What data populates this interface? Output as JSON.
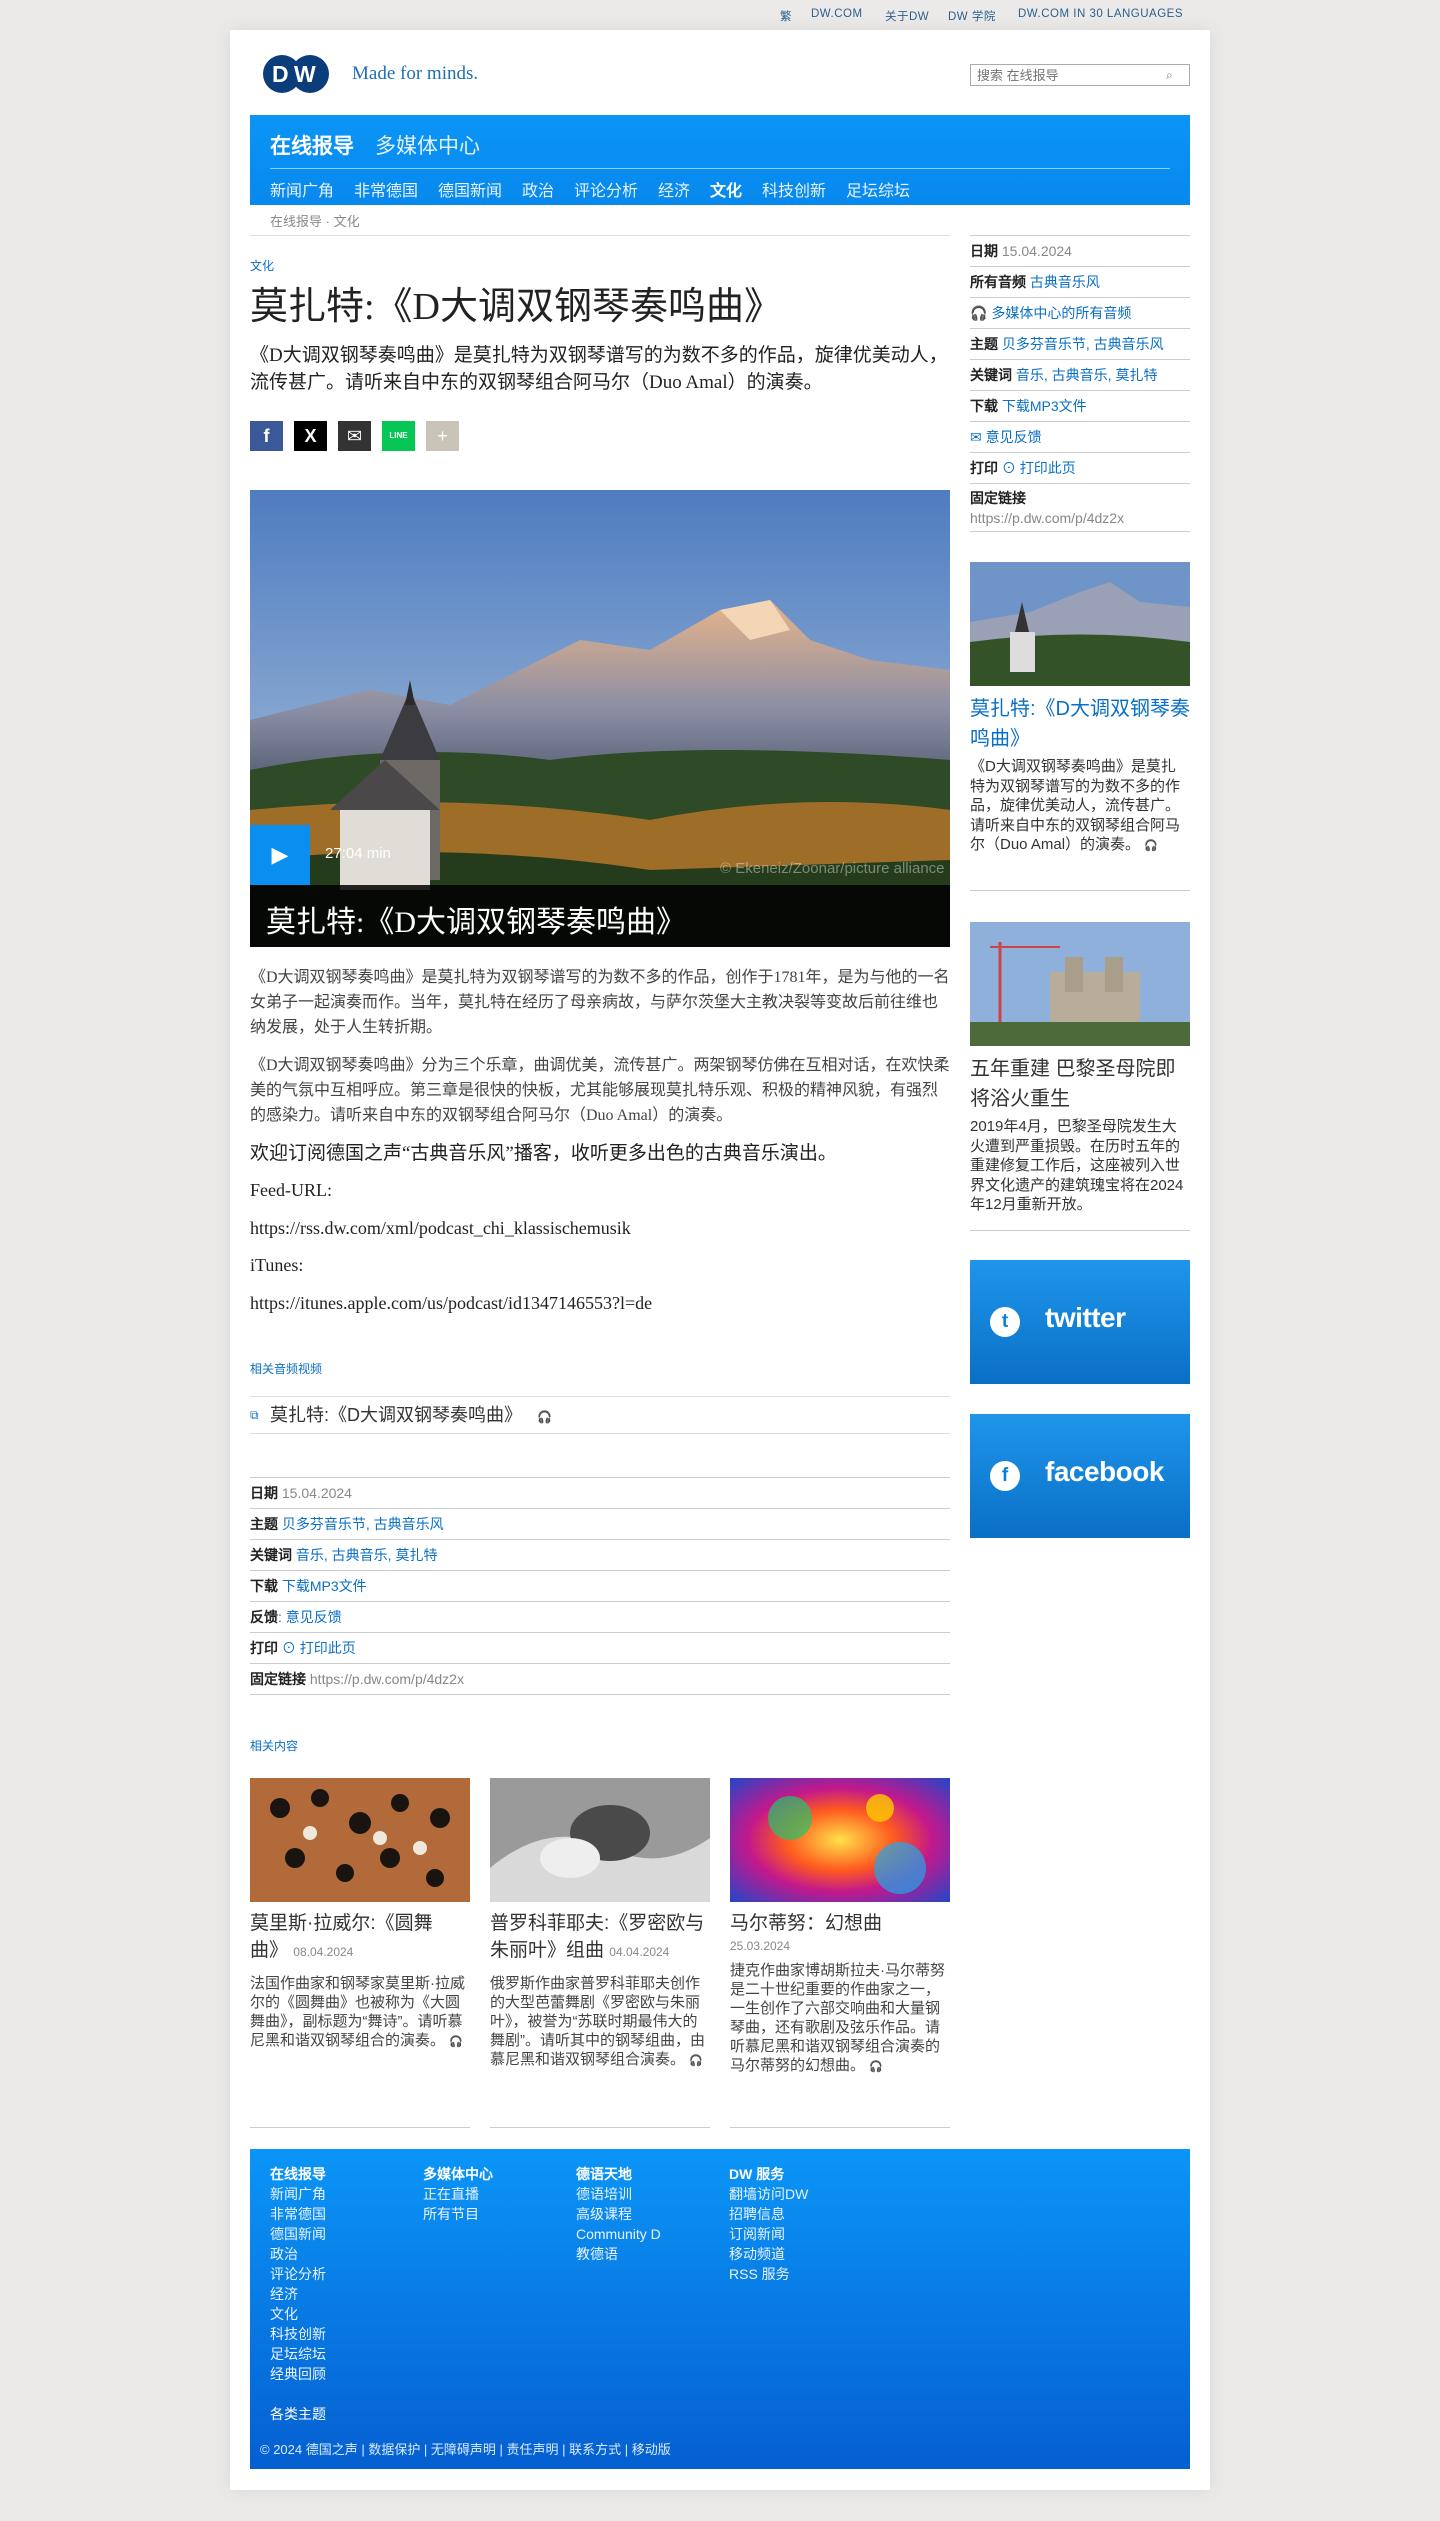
{
  "topbar": {
    "trad": "繁",
    "dwcom": "DW.COM",
    "about": "关于DW",
    "academy": "DW 学院",
    "languages": "DW.COM IN 30 LANGUAGES"
  },
  "header": {
    "tagline": "Made for minds.",
    "search_placeholder": "搜索 在线报导"
  },
  "nav": {
    "main": [
      "在线报导",
      "多媒体中心"
    ],
    "items": [
      "新闻广角",
      "非常德国",
      "德国新闻",
      "政治",
      "评论分析",
      "经济",
      "文化",
      "科技创新",
      "足坛综坛"
    ],
    "active": "文化"
  },
  "breadcrumb": {
    "home": "在线报导",
    "sep": "·",
    "current": "文化"
  },
  "article": {
    "category": "文化",
    "title": "莫扎特:《D大调双钢琴奏鸣曲》",
    "teaser": "《D大调双钢琴奏鸣曲》是莫扎特为双钢琴谱写的为数不多的作品，旋律优美动人，流传甚广。请听来自中东的双钢琴组合阿马尔（Duo Amal）的演奏。",
    "share": {
      "facebook": "f",
      "x": "X",
      "mail": "✉",
      "line": "LINE",
      "more": "+"
    },
    "hero": {
      "duration": "27:04 min",
      "caption": "莫扎特:《D大调双钢琴奏鸣曲》",
      "copyright": "© Ekeneiz/Zoonar/picture alliance"
    },
    "p1": "《D大调双钢琴奏鸣曲》是莫扎特为双钢琴谱写的为数不多的作品，创作于1781年，是为与他的一名女弟子一起演奏而作。当年，莫扎特在经历了母亲病故，与萨尔茨堡大主教决裂等变故后前往维也纳发展，处于人生转折期。",
    "p2": "《D大调双钢琴奏鸣曲》分为三个乐章，曲调优美，流传甚广。两架钢琴仿佛在互相对话，在欢快柔美的气氛中互相呼应。第三章是很快的快板，尤其能够展现莫扎特乐观、积极的精神风貌，有强烈的感染力。请听来自中东的双钢琴组合阿马尔（Duo Amal）的演奏。",
    "p3": "欢迎订阅德国之声“古典音乐风”播客，收听更多出色的古典音乐演出。",
    "p4": "Feed-URL:",
    "p5": "https://rss.dw.com/xml/podcast_chi_klassischemusik",
    "p6": "iTunes:",
    "p7": "https://itunes.apple.com/us/podcast/id1347146553?l=de"
  },
  "related_av": {
    "heading": "相关音频视频",
    "item": "莫扎特:《D大调双钢琴奏鸣曲》"
  },
  "info": [
    {
      "label": "日期",
      "value": "15.04.2024",
      "kind": "plain"
    },
    {
      "label": "主题",
      "value": "贝多芬音乐节, 古典音乐风",
      "kind": "link"
    },
    {
      "label": "关键词",
      "value": "音乐, 古典音乐, 莫扎特",
      "kind": "link"
    },
    {
      "label": "下载",
      "value": "下载MP3文件",
      "kind": "link"
    },
    {
      "label": "反馈",
      "value": ": 意见反馈",
      "kind": "link"
    },
    {
      "label": "打印",
      "value": "⊙ 打印此页",
      "kind": "link"
    },
    {
      "label": "固定链接",
      "value": "https://p.dw.com/p/4dz2x",
      "kind": "plain"
    }
  ],
  "related": {
    "heading": "相关内容",
    "cards": [
      {
        "title": "莫里斯·拉威尔:《圆舞曲》",
        "date": "08.04.2024",
        "text": "法国作曲家和钢琴家莫里斯·拉威尔的《圆舞曲》也被称为《大圆舞曲》，副标题为“舞诗”。请听慕尼黑和谐双钢琴组合的演奏。"
      },
      {
        "title": "普罗科菲耶夫:《罗密欧与朱丽叶》组曲",
        "date": "04.04.2024",
        "text": "俄罗斯作曲家普罗科菲耶夫创作的大型芭蕾舞剧《罗密欧与朱丽叶》，被誉为“苏联时期最伟大的舞剧”。请听其中的钢琴组曲，由慕尼黑和谐双钢琴组合演奏。"
      },
      {
        "title": "马尔蒂努：幻想曲",
        "date": "25.03.2024",
        "text": "捷克作曲家博胡斯拉夫·马尔蒂努是二十世纪重要的作曲家之一，一生创作了六部交响曲和大量钢琴曲，还有歌剧及弦乐作品。请听慕尼黑和谐双钢琴组合演奏的马尔蒂努的幻想曲。"
      }
    ]
  },
  "sidebar": {
    "rows": [
      {
        "label": "日期",
        "value": "15.04.2024",
        "kind": "plain"
      },
      {
        "label": "所有音频",
        "value": "古典音乐风",
        "kind": "link"
      },
      {
        "label": "",
        "value": "🎧 多媒体中心的所有音频",
        "kind": "link"
      },
      {
        "label": "主题",
        "value": "贝多芬音乐节, 古典音乐风",
        "kind": "link"
      },
      {
        "label": "关键词",
        "value": "音乐, 古典音乐, 莫扎特",
        "kind": "link"
      },
      {
        "label": "下载",
        "value": "下载MP3文件",
        "kind": "link"
      },
      {
        "label": "",
        "value": "✉ 意见反馈",
        "kind": "link"
      },
      {
        "label": "打印",
        "value": "⊙ 打印此页",
        "kind": "link"
      }
    ],
    "permalink_label": "固定链接",
    "permalink": "https://p.dw.com/p/4dz2x",
    "teaser1": {
      "title": "莫扎特:《D大调双钢琴奏鸣曲》",
      "text": "《D大调双钢琴奏鸣曲》是莫扎特为双钢琴谱写的为数不多的作品，旋律优美动人，流传甚广。请听来自中东的双钢琴组合阿马尔（Duo Amal）的演奏。"
    },
    "teaser2": {
      "title": "五年重建 巴黎圣母院即将浴火重生",
      "text": "2019年4月，巴黎圣母院发生大火遭到严重损毁。在历时五年的重建修复工作后，这座被列入世界文化遗产的建筑瑰宝将在2024年12月重新开放。"
    },
    "twitter": "twitter",
    "facebook": "facebook"
  },
  "footer": {
    "col1": {
      "head": "在线报导",
      "items": [
        "新闻广角",
        "非常德国",
        "德国新闻",
        "政治",
        "评论分析",
        "经济",
        "文化",
        "科技创新",
        "足坛综坛",
        "经典回顾"
      ]
    },
    "col2": {
      "head": "多媒体中心",
      "items": [
        "正在直播",
        "所有节目"
      ]
    },
    "col3": {
      "head": "德语天地",
      "items": [
        "德语培训",
        "高级课程",
        "Community D",
        "教德语"
      ]
    },
    "col4": {
      "head": "DW 服务",
      "items": [
        "翻墙访问DW",
        "招聘信息",
        "订阅新闻",
        "移动频道",
        "RSS 服务"
      ]
    },
    "more": "各类主题",
    "copyright": "© 2024 德国之声 | 数据保护 | 无障碍声明 | 责任声明 | 联系方式 | 移动版"
  },
  "colors": {
    "brand": "#0a8ff0",
    "link": "#0a6fc6"
  }
}
